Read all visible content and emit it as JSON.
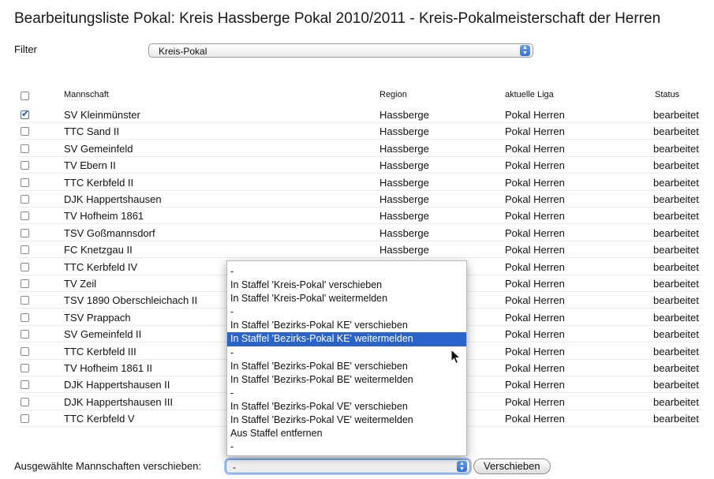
{
  "page_title": "Bearbeitungsliste Pokal: Kreis Hassberge Pokal 2010/2011 - Kreis-Pokalmeisterschaft der Herren",
  "filter": {
    "label": "Filter",
    "selected": "Kreis-Pokal"
  },
  "table": {
    "headers": {
      "mannschaft": "Mannschaft",
      "region": "Region",
      "liga": "aktuelle Liga",
      "status": "Status"
    },
    "rows": [
      {
        "name": "SV Kleinmünster",
        "region": "Hassberge",
        "liga": "Pokal Herren",
        "status": "bearbeitet",
        "checked": true
      },
      {
        "name": "TTC Sand II",
        "region": "Hassberge",
        "liga": "Pokal Herren",
        "status": "bearbeitet",
        "checked": false
      },
      {
        "name": "SV Gemeinfeld",
        "region": "Hassberge",
        "liga": "Pokal Herren",
        "status": "bearbeitet",
        "checked": false
      },
      {
        "name": "TV Ebern II",
        "region": "Hassberge",
        "liga": "Pokal Herren",
        "status": "bearbeitet",
        "checked": false
      },
      {
        "name": "TTC Kerbfeld II",
        "region": "Hassberge",
        "liga": "Pokal Herren",
        "status": "bearbeitet",
        "checked": false
      },
      {
        "name": "DJK Happertshausen",
        "region": "Hassberge",
        "liga": "Pokal Herren",
        "status": "bearbeitet",
        "checked": false
      },
      {
        "name": "TV Hofheim 1861",
        "region": "Hassberge",
        "liga": "Pokal Herren",
        "status": "bearbeitet",
        "checked": false
      },
      {
        "name": "TSV Goßmannsdorf",
        "region": "Hassberge",
        "liga": "Pokal Herren",
        "status": "bearbeitet",
        "checked": false
      },
      {
        "name": "FC Knetzgau II",
        "region": "Hassberge",
        "liga": "Pokal Herren",
        "status": "bearbeitet",
        "checked": false
      },
      {
        "name": "TTC Kerbfeld IV",
        "region": "",
        "liga": "Pokal Herren",
        "status": "bearbeitet",
        "checked": false
      },
      {
        "name": "TV Zeil",
        "region": "",
        "liga": "Pokal Herren",
        "status": "bearbeitet",
        "checked": false
      },
      {
        "name": "TSV 1890 Oberschleichach II",
        "region": "",
        "liga": "Pokal Herren",
        "status": "bearbeitet",
        "checked": false
      },
      {
        "name": "TSV Prappach",
        "region": "",
        "liga": "Pokal Herren",
        "status": "bearbeitet",
        "checked": false
      },
      {
        "name": "SV Gemeinfeld II",
        "region": "",
        "liga": "Pokal Herren",
        "status": "bearbeitet",
        "checked": false
      },
      {
        "name": "TTC Kerbfeld III",
        "region": "",
        "liga": "Pokal Herren",
        "status": "bearbeitet",
        "checked": false
      },
      {
        "name": "TV Hofheim 1861 II",
        "region": "",
        "liga": "Pokal Herren",
        "status": "bearbeitet",
        "checked": false
      },
      {
        "name": "DJK Happertshausen II",
        "region": "",
        "liga": "Pokal Herren",
        "status": "bearbeitet",
        "checked": false
      },
      {
        "name": "DJK Happertshausen III",
        "region": "",
        "liga": "Pokal Herren",
        "status": "bearbeitet",
        "checked": false
      },
      {
        "name": "TTC Kerbfeld V",
        "region": "",
        "liga": "Pokal Herren",
        "status": "bearbeitet",
        "checked": false
      }
    ]
  },
  "dropdown": {
    "options": [
      "-",
      "In Staffel 'Kreis-Pokal' verschieben",
      "In Staffel 'Kreis-Pokal' weitermelden",
      "-",
      "In Staffel 'Bezirks-Pokal KE' verschieben",
      "In Staffel 'Bezirks-Pokal KE' weitermelden",
      "-",
      "In Staffel 'Bezirks-Pokal BE' verschieben",
      "In Staffel 'Bezirks-Pokal BE' weitermelden",
      "-",
      "In Staffel 'Bezirks-Pokal VE' verschieben",
      "In Staffel 'Bezirks-Pokal VE' weitermelden",
      "Aus Staffel entfernen",
      "-"
    ],
    "highlighted_index": 5
  },
  "bottom": {
    "label": "Ausgewählte Mannschaften verschieben:",
    "selected": "-",
    "button_label": "Verschieben"
  },
  "icons": {
    "cursor": "arrow-cursor-icon",
    "select_arrow": "updown-arrow-icon",
    "checkbox": "checkbox-icon"
  },
  "colors": {
    "highlight": "#2a63c9",
    "select_arrow": "#3a7ae0"
  }
}
